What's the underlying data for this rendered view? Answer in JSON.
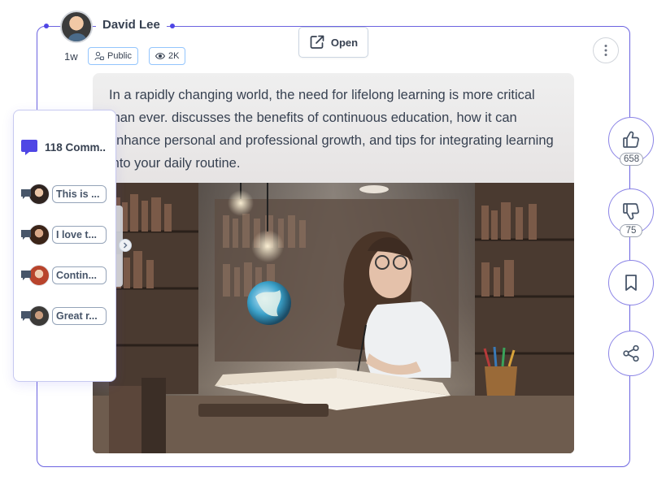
{
  "author": {
    "name": "David Lee",
    "time": "1w"
  },
  "chips": {
    "visibility": "Public",
    "views": "2K"
  },
  "open_label": "Open",
  "post": {
    "text": "In a rapidly changing world, the need for lifelong learning is more critical than ever. discusses the benefits of continuous education, how it can enhance personal and professional growth, and tips for integrating learning into your daily routine."
  },
  "comments": {
    "count_label": "118 Comm..",
    "items": [
      {
        "snippet": "This is ..."
      },
      {
        "snippet": "I love t..."
      },
      {
        "snippet": "Contin..."
      },
      {
        "snippet": "Great r..."
      }
    ]
  },
  "actions": {
    "likes": "658",
    "dislikes": "75"
  },
  "colors": {
    "accent": "#4f46e5",
    "card_border": "#6b63e0",
    "chip_border": "#93c5fd"
  }
}
